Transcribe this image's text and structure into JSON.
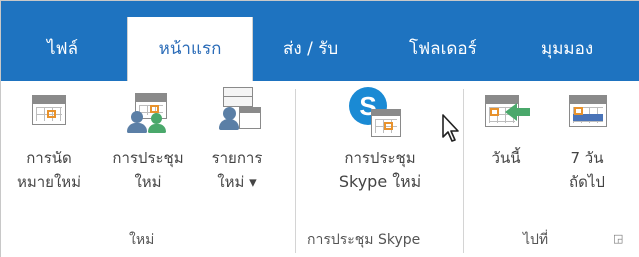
{
  "tabs": [
    {
      "label": "ไฟล์",
      "active": false
    },
    {
      "label": "หน้าแรก",
      "active": true
    },
    {
      "label": "ส่ง / รับ",
      "active": false
    },
    {
      "label": "โฟลเดอร์",
      "active": false
    },
    {
      "label": "มุมมอง",
      "active": false
    }
  ],
  "groups": {
    "new": {
      "label": "ใหม่",
      "buttons": {
        "new_appointment": {
          "line1": "การนัด",
          "line2": "หมายใหม่"
        },
        "new_meeting": {
          "line1": "การประชุม",
          "line2": "ใหม่"
        },
        "new_items": {
          "line1": "รายการ",
          "line2": "ใหม่ ▾"
        }
      }
    },
    "skype": {
      "label": "การประชุม Skype",
      "buttons": {
        "new_skype_meeting": {
          "line1": "การประชุม",
          "line2": "Skype ใหม่"
        }
      }
    },
    "goto": {
      "label": "ไปที่",
      "buttons": {
        "today": {
          "line1": "วันนี้"
        },
        "next_7_days": {
          "line1": "7 วัน",
          "line2": "ถัดไป"
        }
      }
    }
  },
  "colors": {
    "tab_bar": "#1e73c0",
    "accent_orange": "#e8922c",
    "skype_blue": "#1a8ad4",
    "arrow_green": "#4aa86b"
  }
}
